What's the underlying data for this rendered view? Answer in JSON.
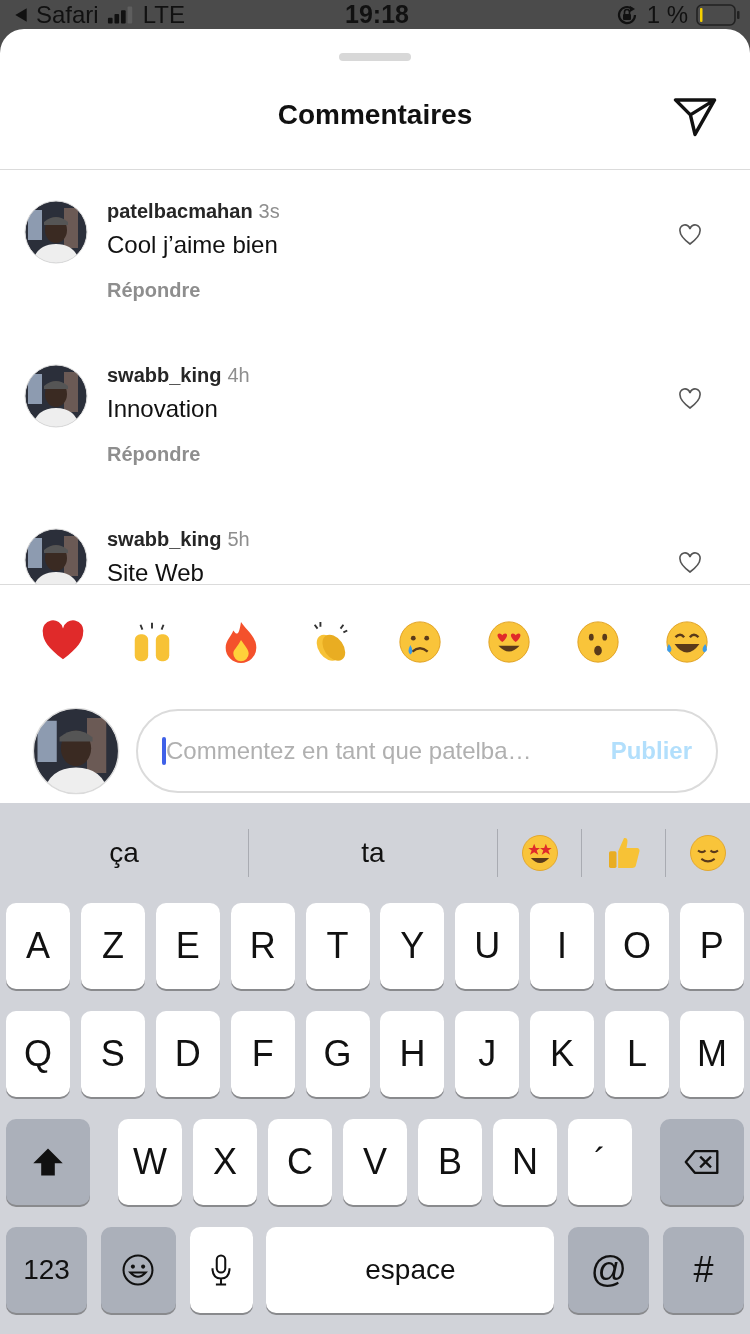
{
  "status_bar": {
    "back_app": "Safari",
    "network": "LTE",
    "time": "19:18",
    "battery": "1 %"
  },
  "header": {
    "title": "Commentaires"
  },
  "comments": [
    {
      "user": "patelbacmahan",
      "time": "3s",
      "text": "Cool j’aime bien",
      "reply": "Répondre"
    },
    {
      "user": "swabb_king",
      "time": "4h",
      "text": "Innovation",
      "reply": "Répondre"
    },
    {
      "user": "swabb_king",
      "time": "5h",
      "text": "Site Web"
    }
  ],
  "composer": {
    "placeholder": "Commentez en tant que patelba…",
    "publish": "Publier",
    "disabled": true
  },
  "keyboard": {
    "suggestions": [
      {
        "kind": "word",
        "text": "ça"
      },
      {
        "kind": "word",
        "text": "ta"
      },
      {
        "kind": "emoji"
      },
      {
        "kind": "emoji"
      },
      {
        "kind": "emoji"
      }
    ],
    "rows": [
      [
        "A",
        "Z",
        "E",
        "R",
        "T",
        "Y",
        "U",
        "I",
        "O",
        "P"
      ],
      [
        "Q",
        "S",
        "D",
        "F",
        "G",
        "H",
        "J",
        "K",
        "L",
        "M"
      ],
      [
        "W",
        "X",
        "C",
        "V",
        "B",
        "N",
        "´"
      ]
    ],
    "bottom": {
      "numbers": "123",
      "space": "espace",
      "at": "@",
      "hash": "#"
    }
  }
}
